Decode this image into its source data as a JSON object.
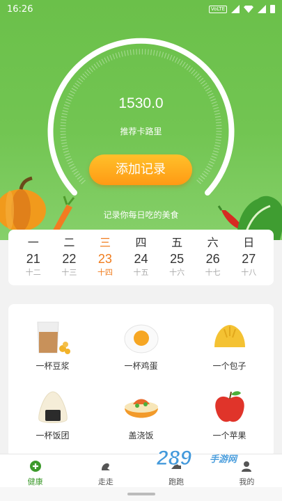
{
  "status": {
    "time": "16:26",
    "network": "VoLTE"
  },
  "gauge": {
    "value": "1530.0",
    "label": "推荐卡路里"
  },
  "add_button": "添加记录",
  "hint": "记录你每日吃的美食",
  "calendar": {
    "days": [
      {
        "weekday": "一",
        "date": "21",
        "lunar": "十二"
      },
      {
        "weekday": "二",
        "date": "22",
        "lunar": "十三"
      },
      {
        "weekday": "三",
        "date": "23",
        "lunar": "十四"
      },
      {
        "weekday": "四",
        "date": "24",
        "lunar": "十五"
      },
      {
        "weekday": "五",
        "date": "25",
        "lunar": "十六"
      },
      {
        "weekday": "六",
        "date": "26",
        "lunar": "十七"
      },
      {
        "weekday": "日",
        "date": "27",
        "lunar": "十八"
      }
    ],
    "active_index": 2
  },
  "foods": [
    {
      "name": "一杯豆浆",
      "icon": "soymilk-icon"
    },
    {
      "name": "一杯鸡蛋",
      "icon": "egg-icon"
    },
    {
      "name": "一个包子",
      "icon": "bun-icon"
    },
    {
      "name": "一杯饭团",
      "icon": "rice-ball-icon"
    },
    {
      "name": "盖浇饭",
      "icon": "rice-bowl-icon"
    },
    {
      "name": "一个苹果",
      "icon": "apple-icon"
    }
  ],
  "tabs": [
    {
      "label": "健康",
      "icon": "health-icon",
      "active": true
    },
    {
      "label": "走走",
      "icon": "walk-icon",
      "active": false
    },
    {
      "label": "跑跑",
      "icon": "run-icon",
      "active": false
    },
    {
      "label": "我的",
      "icon": "profile-icon",
      "active": false
    }
  ],
  "watermark": {
    "text": "289",
    "sub": "手游网"
  },
  "colors": {
    "green": "#6bc04a",
    "orange": "#ff9a14",
    "active_text": "#f07c1d",
    "tab_active": "#3d9a2c"
  }
}
